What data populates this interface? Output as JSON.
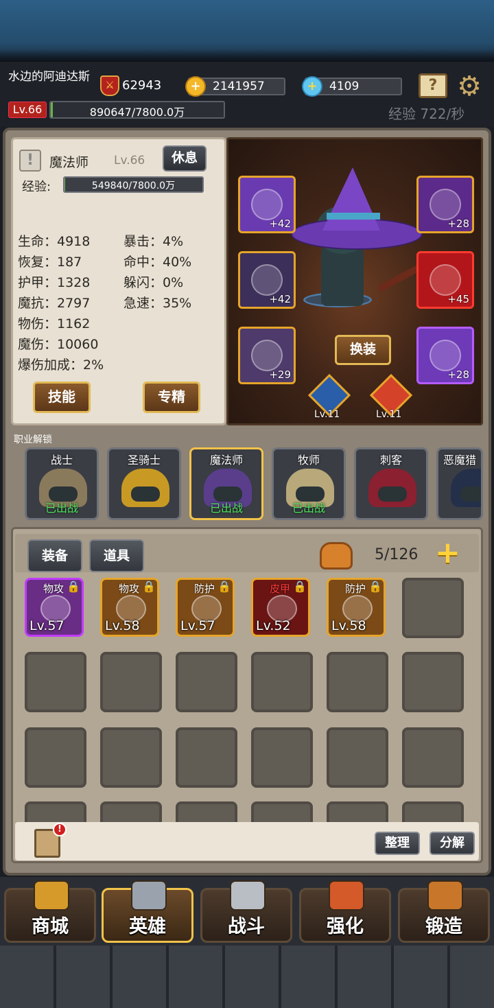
{
  "header": {
    "player_name": "水边的阿迪达斯",
    "level": "Lv.66",
    "exp": "890647/7800.0万",
    "exp_fraction": 0.011,
    "power": "62943",
    "gold": "2141957",
    "diamonds": "4109",
    "exp_rate": "经验 722/秒"
  },
  "hero": {
    "class_name": "魔法师",
    "level": "Lv.66",
    "rest_label": "休息",
    "exp_label": "经验:",
    "exp_value": "549840/7800.0万",
    "exp_fraction": 0.007,
    "stats_left": [
      "生命：4918",
      "恢复：187",
      "护甲：1328",
      "魔抗：2797",
      "物伤：1162",
      "魔伤：10060",
      "爆伤加成：2%"
    ],
    "stats_right": [
      "暴击：4%",
      "命中：40%",
      "躲闪：0%",
      "急速：35%"
    ],
    "skills_label": "技能",
    "specialize_label": "专精"
  },
  "equipment": {
    "change_label": "换装",
    "slots": [
      {
        "icon": "hood-icon",
        "bonus": "+42",
        "color": "#6a3bb0"
      },
      {
        "icon": "amulet-icon",
        "bonus": "+28",
        "color": "#5c2a8a"
      },
      {
        "icon": "robe-icon",
        "bonus": "+42",
        "color": "#3c2f5a"
      },
      {
        "icon": "staff-icon",
        "bonus": "+45",
        "color": "#b3161a"
      },
      {
        "icon": "boots-icon",
        "bonus": "+29",
        "color": "#4e3a6b"
      },
      {
        "icon": "ring-icon",
        "bonus": "+28",
        "color": "#6e3ab8"
      }
    ],
    "emblems": [
      "Lv.11",
      "Lv.11"
    ]
  },
  "classes": {
    "title": "职业解锁",
    "items": [
      {
        "name": "战士",
        "status": "已出战",
        "color": "#8a7a5c"
      },
      {
        "name": "圣骑士",
        "status": "",
        "color": "#c89a24"
      },
      {
        "name": "魔法师",
        "status": "已出战",
        "color": "#5a3e8c"
      },
      {
        "name": "牧师",
        "status": "已出战",
        "color": "#b8a87a"
      },
      {
        "name": "刺客",
        "status": "",
        "color": "#8a2030"
      },
      {
        "name": "恶魔猎",
        "status": "",
        "color": "#24304a"
      }
    ]
  },
  "inventory": {
    "tab_equipment": "装备",
    "tab_items": "道具",
    "capacity": "5/126",
    "items": [
      {
        "tag": "物攻",
        "level": "Lv.57",
        "border": "#c13cff",
        "bg": "#6a2d86",
        "tag_color": "#ffffff"
      },
      {
        "tag": "物攻",
        "level": "Lv.58",
        "border": "#e6a52a",
        "bg": "#7b4a17",
        "tag_color": "#ffffff"
      },
      {
        "tag": "防护",
        "level": "Lv.57",
        "border": "#e6a52a",
        "bg": "#7b4a17",
        "tag_color": "#ffffff"
      },
      {
        "tag": "皮甲",
        "level": "Lv.52",
        "border": "#e6a52a",
        "bg": "#6b1414",
        "tag_color": "#ff3b3b"
      },
      {
        "tag": "防护",
        "level": "Lv.58",
        "border": "#e6a52a",
        "bg": "#7b4a17",
        "tag_color": "#ffffff"
      }
    ],
    "sort_label": "整理",
    "decompose_label": "分解"
  },
  "nav": [
    {
      "label": "商城",
      "icon": "chest-icon"
    },
    {
      "label": "英雄",
      "icon": "helmet-icon"
    },
    {
      "label": "战斗",
      "icon": "swords-icon"
    },
    {
      "label": "强化",
      "icon": "hammer-icon"
    },
    {
      "label": "锻造",
      "icon": "forge-icon"
    }
  ]
}
